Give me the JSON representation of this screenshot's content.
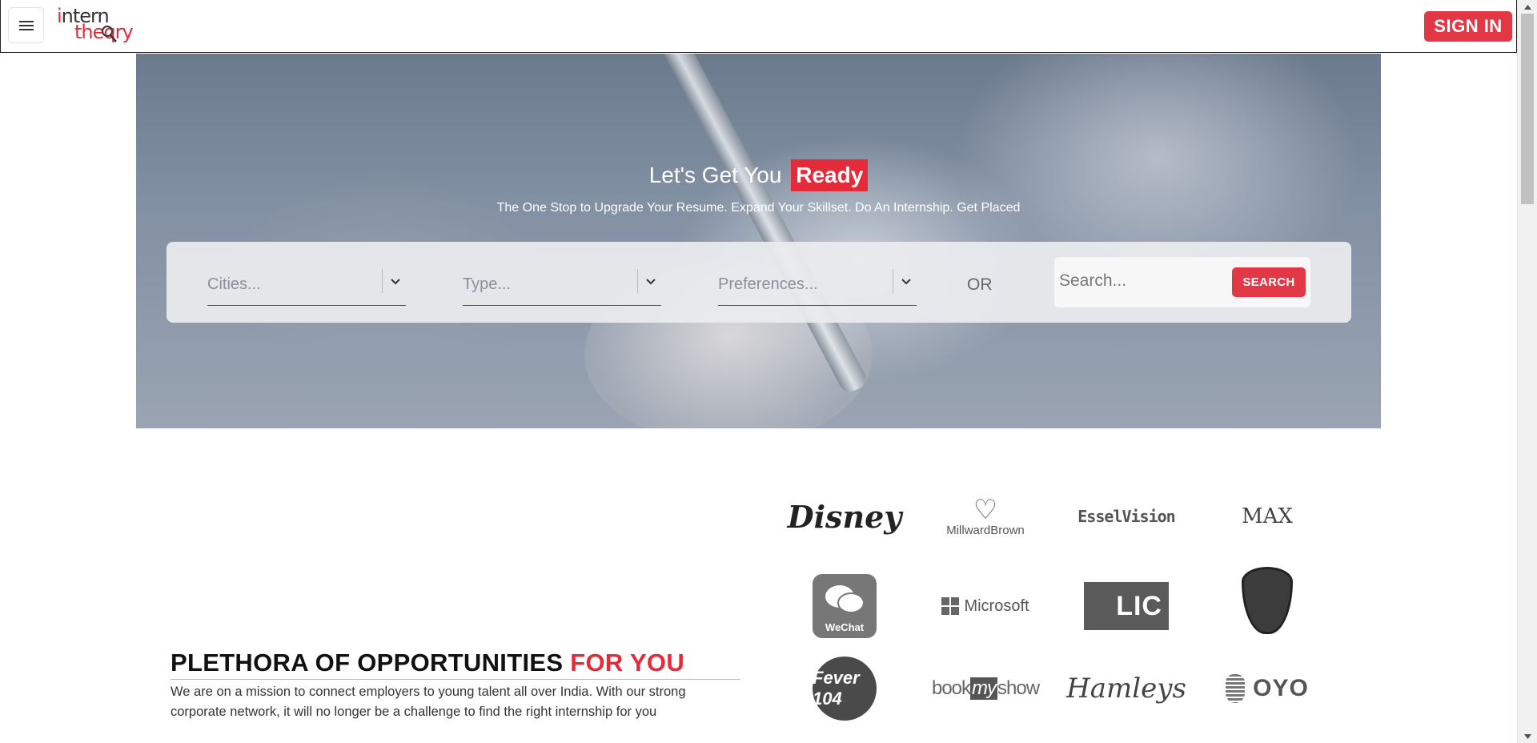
{
  "header": {
    "menu_icon": "hamburger-menu-icon",
    "logo": {
      "line1": "intern",
      "line2": "theqry",
      "alt": "internshala-style logo"
    },
    "signin_label": "SIGN IN",
    "brand_color": "#e23745"
  },
  "hero": {
    "title_prefix": "Let's Get You",
    "title_highlight": "Ready",
    "subtitle": "The One Stop to Upgrade Your Resume. Expand Your Skillset. Do An Internship. Get Placed",
    "filters": [
      {
        "placeholder": "Cities..."
      },
      {
        "placeholder": "Type..."
      },
      {
        "placeholder": "Preferences..."
      }
    ],
    "or_text": "OR",
    "search_placeholder": "Search...",
    "search_button": "SEARCH"
  },
  "opportunities": {
    "heading_main": "PLETHORA OF OPPORTUNITIES",
    "heading_accent": "FOR YOU",
    "paragraph": "We are on a mission to connect employers to young talent all over India. With our strong corporate network, it will no longer be a challenge to find the right internship for you"
  },
  "partner_logos": {
    "disney": "Disney",
    "millward": "MillwardBrown",
    "essel": "EsselVision",
    "max": "MAX",
    "wechat": "WeChat",
    "microsoft": "Microsoft",
    "lic": "LIC",
    "porsche": "porsche-crest",
    "fever": "Fever 104",
    "bms_book": "book",
    "bms_my": "my",
    "bms_show": "show",
    "hamleys": "Hamleys",
    "oyo": "OYO"
  }
}
